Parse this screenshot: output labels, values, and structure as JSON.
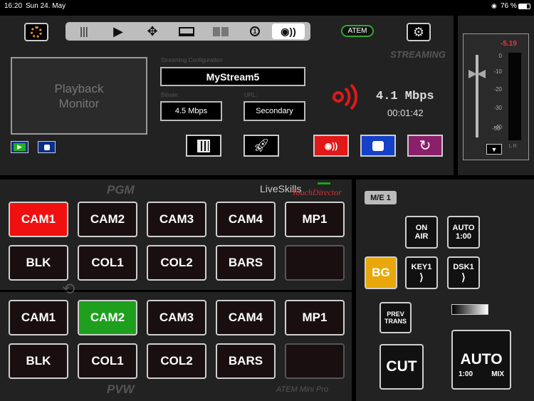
{
  "status": {
    "time": "16:20",
    "date": "Sun 24. May",
    "battery": "76 %"
  },
  "toolbar": {
    "items": [
      "mixer-icon",
      "play-icon",
      "move-icon",
      "display-icon",
      "multiview-icon",
      "one-icon",
      "stream-icon"
    ],
    "atem_label": "ATEM"
  },
  "streaming": {
    "section_title": "STREAMING",
    "monitor_label": "Playback Monitor",
    "config_label": "Streaming Configuration",
    "stream_name": "MyStream5",
    "bitrate_label": "Bitrate:",
    "bitrate_value": "4.5 Mbps",
    "url_label": "URL:",
    "url_value": "Secondary",
    "rate": "4.1 Mbps",
    "elapsed": "00:01:42",
    "colors": {
      "record": "#e01818",
      "stop": "#1540c8",
      "restart": "#8a1f6a"
    }
  },
  "audio": {
    "peak": "-5.19",
    "scale": [
      "0",
      "-10",
      "-20",
      "-30",
      "-40",
      "-50"
    ],
    "channels": "L R"
  },
  "switcher": {
    "pgm_label": "PGM",
    "pvw_label": "PVW",
    "brand": "LiveSkills",
    "brand_sub": "TouchDirector",
    "model": "ATEM Mini Pro",
    "pgm_row1": [
      "CAM1",
      "CAM2",
      "CAM3",
      "CAM4",
      "MP1"
    ],
    "pgm_row2": [
      "BLK",
      "COL1",
      "COL2",
      "BARS",
      ""
    ],
    "pvw_row1": [
      "CAM1",
      "CAM2",
      "CAM3",
      "CAM4",
      "MP1"
    ],
    "pvw_row2": [
      "BLK",
      "COL1",
      "COL2",
      "BARS",
      ""
    ],
    "pgm_active": "CAM1",
    "pvw_active": "CAM2",
    "colors": {
      "pgm": "#f01010",
      "pvw": "#1ea01e",
      "bg": "#e8a80c"
    }
  },
  "transition": {
    "me_label": "M/E 1",
    "on_air_1": "ON",
    "on_air_2": "AIR",
    "auto_label": "AUTO",
    "auto_time": "1:00",
    "bg_label": "BG",
    "key1_label": "KEY1",
    "dsk1_label": "DSK1",
    "prev_1": "PREV",
    "prev_2": "TRANS",
    "cut_label": "CUT",
    "big_auto": "AUTO",
    "big_time": "1:00",
    "big_mix": "MIX"
  }
}
